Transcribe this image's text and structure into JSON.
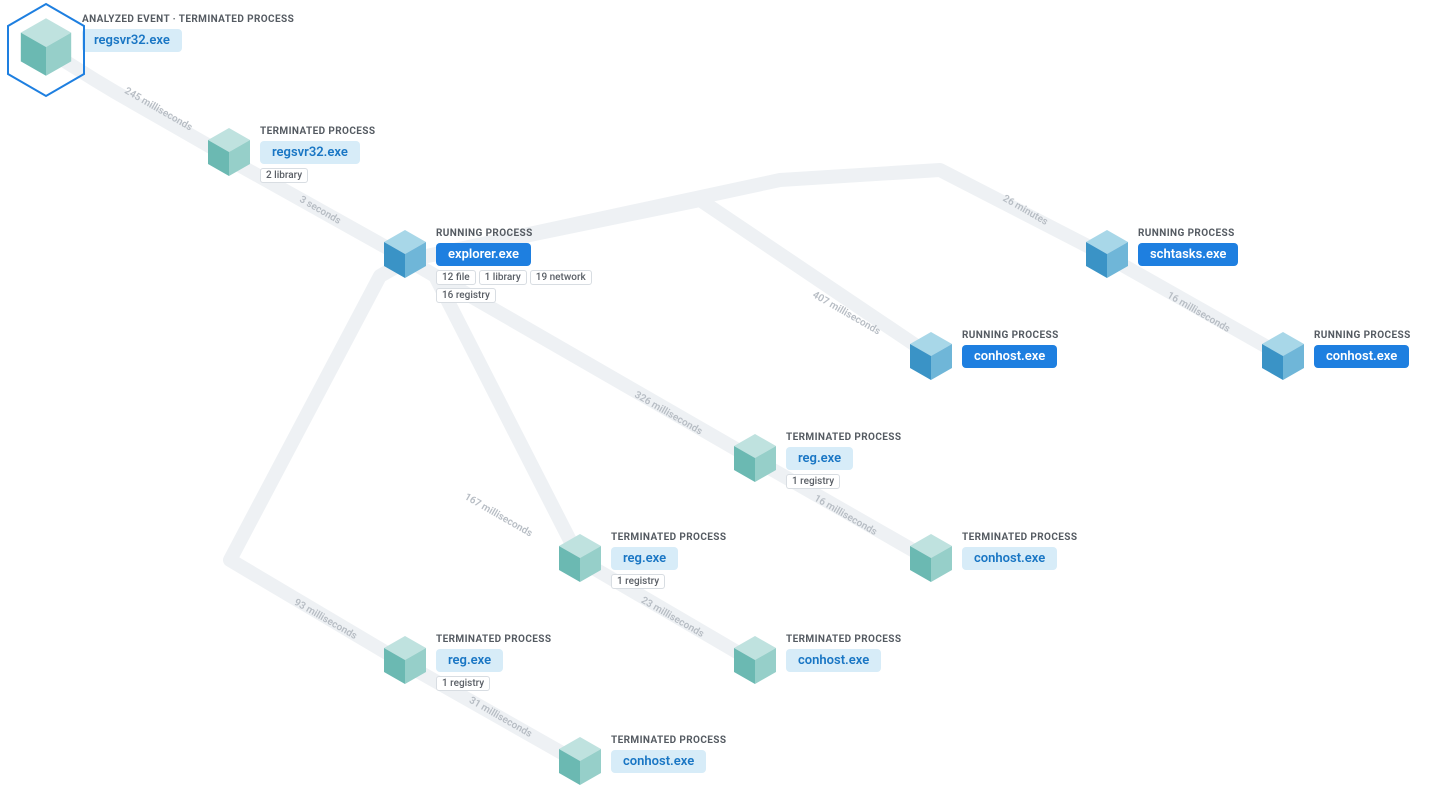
{
  "root_prefix": "ANALYZED EVENT",
  "status": {
    "terminated": "TERMINATED PROCESS",
    "running": "RUNNING PROCESS"
  },
  "nodes": {
    "n0": {
      "status": "terminated",
      "name": "regsvr32.exe",
      "badges": []
    },
    "n1": {
      "status": "terminated",
      "name": "regsvr32.exe",
      "badges": [
        "2 library"
      ]
    },
    "n2": {
      "status": "running",
      "name": "explorer.exe",
      "badges": [
        "12 file",
        "1 library",
        "19 network",
        "16 registry"
      ]
    },
    "n3": {
      "status": "terminated",
      "name": "reg.exe",
      "badges": [
        "1 registry"
      ]
    },
    "n31": {
      "status": "terminated",
      "name": "conhost.exe",
      "badges": []
    },
    "n4": {
      "status": "terminated",
      "name": "reg.exe",
      "badges": [
        "1 registry"
      ]
    },
    "n41": {
      "status": "terminated",
      "name": "conhost.exe",
      "badges": []
    },
    "n5": {
      "status": "terminated",
      "name": "reg.exe",
      "badges": [
        "1 registry"
      ]
    },
    "n51": {
      "status": "terminated",
      "name": "conhost.exe",
      "badges": []
    },
    "n6": {
      "status": "running",
      "name": "conhost.exe",
      "badges": []
    },
    "n7": {
      "status": "running",
      "name": "schtasks.exe",
      "badges": []
    },
    "n71": {
      "status": "running",
      "name": "conhost.exe",
      "badges": []
    }
  },
  "edges": {
    "e0": "245 milliseconds",
    "e1": "3 seconds",
    "e2": "326 milliseconds",
    "e3": "167 milliseconds",
    "e4": "93 milliseconds",
    "e5": "407 milliseconds",
    "e6": "26 minutes",
    "e7": "16 milliseconds",
    "e8": "31 milliseconds",
    "e9": "23 milliseconds",
    "e10": "16 milliseconds"
  }
}
